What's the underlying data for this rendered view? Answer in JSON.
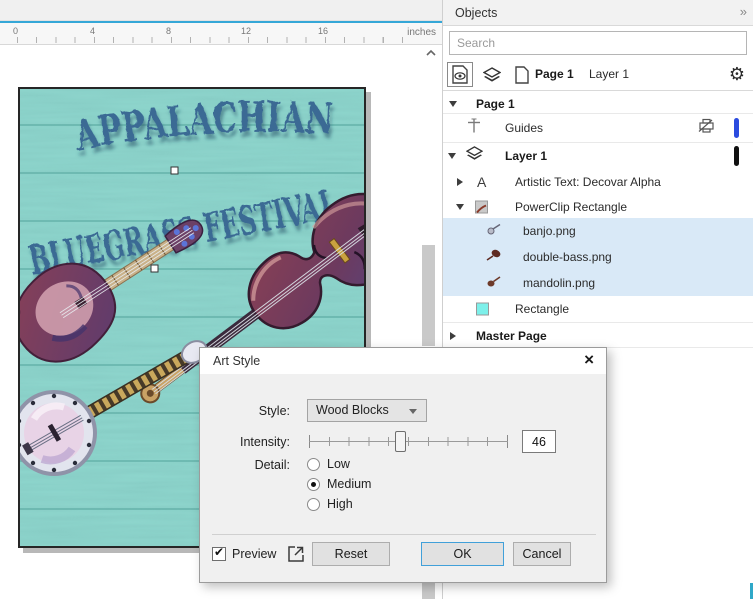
{
  "icons": {
    "flyout": "»",
    "gear": "⚙",
    "close": "×",
    "check": "✔",
    "artistic_text": "A"
  },
  "ruler": {
    "unit": "inches",
    "labels": [
      "0",
      "4",
      "8",
      "12",
      "16"
    ]
  },
  "poster": {
    "line1": "APPALACHIAN",
    "line2": "BLUEGRASS FESTIVAL"
  },
  "panel": {
    "title": "Objects",
    "search_placeholder": "Search",
    "page": "Page 1",
    "layer": "Layer 1",
    "tree": [
      {
        "label": "Page 1",
        "expanded": true
      },
      {
        "label": "Guides"
      },
      {
        "label": "Layer 1",
        "expanded": true
      },
      {
        "label": "Artistic Text: Decovar Alpha",
        "expanded": false
      },
      {
        "label": "PowerClip Rectangle",
        "expanded": true
      },
      {
        "label": "banjo.png",
        "selected": true
      },
      {
        "label": "double-bass.png",
        "selected": true
      },
      {
        "label": "mandolin.png",
        "selected": true
      },
      {
        "label": "Rectangle"
      },
      {
        "label": "Master Page",
        "expanded": false
      }
    ]
  },
  "dialog": {
    "title": "Art Style",
    "style_label": "Style:",
    "style_value": "Wood Blocks",
    "intensity_label": "Intensity:",
    "intensity_value": "46",
    "detail_label": "Detail:",
    "detail_options": [
      "Low",
      "Medium",
      "High"
    ],
    "detail_selected": "Medium",
    "preview_label": "Preview",
    "reset": "Reset",
    "ok": "OK",
    "cancel": "Cancel"
  },
  "colors": {
    "accent_blue": "#35a7d7",
    "selection_bg": "#d9e9f7",
    "poster_teal": "#8fd7ce",
    "title_blue": "#3a6a94",
    "ok_border": "#41a0d9",
    "guides_pill": "#2b4bdf",
    "layer_pill": "#111111"
  }
}
